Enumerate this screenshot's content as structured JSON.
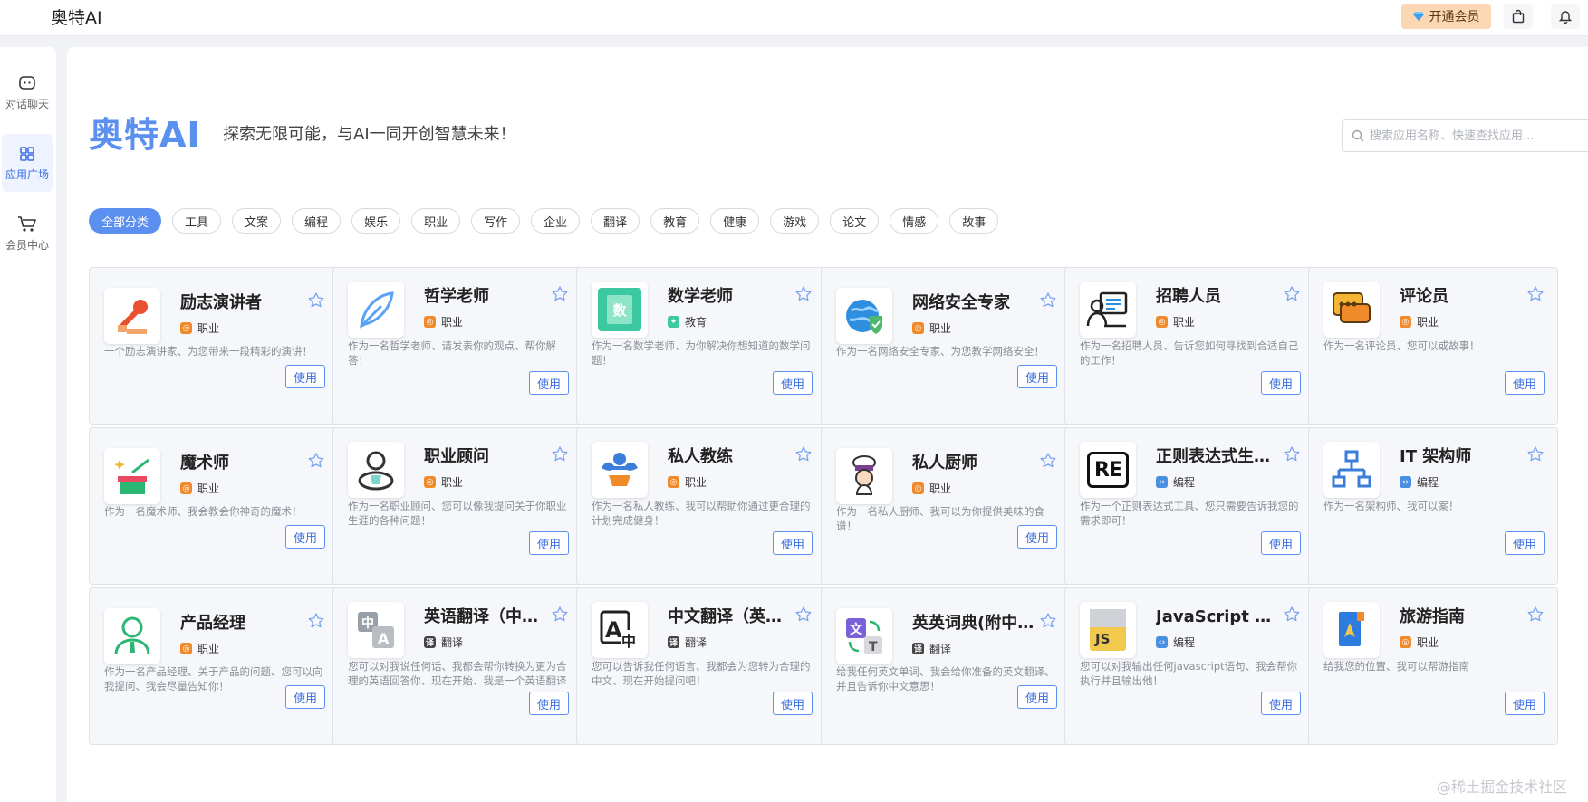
{
  "app": {
    "logo": "奥特AI"
  },
  "header": {
    "vip_label": "开通会员"
  },
  "sidebar": {
    "items": [
      {
        "label": "对话聊天",
        "icon": "chat-icon"
      },
      {
        "label": "应用广场",
        "icon": "grid-icon",
        "active": true
      },
      {
        "label": "会员中心",
        "icon": "cart-icon"
      }
    ]
  },
  "hero": {
    "title": "奥特AI",
    "subtitle": "探索无限可能，与AI一同开创智慧未来！"
  },
  "search": {
    "placeholder": "搜索应用名称、快速查找应用..."
  },
  "categories": [
    "全部分类",
    "工具",
    "文案",
    "编程",
    "娱乐",
    "职业",
    "写作",
    "企业",
    "翻译",
    "教育",
    "健康",
    "游戏",
    "论文",
    "情感",
    "故事"
  ],
  "active_category": "全部分类",
  "use_label": "使用",
  "cards": [
    {
      "title": "励志演讲者",
      "tag": "职业",
      "tag_icon": "career",
      "desc": "一个励志演讲家、为您带来一段精彩的演讲！",
      "icon": "microphone-icon"
    },
    {
      "title": "哲学老师",
      "tag": "职业",
      "tag_icon": "career",
      "desc": "作为一名哲学老师、请发表你的观点、帮你解答！",
      "icon": "feather-icon"
    },
    {
      "title": "数学老师",
      "tag": "教育",
      "tag_icon": "edu",
      "desc": "作为一名数学老师、为你解决你想知道的数学问题！",
      "icon": "math-book-icon",
      "icon_text": "数"
    },
    {
      "title": "网络安全专家",
      "tag": "职业",
      "tag_icon": "career",
      "desc": "作为一名网络安全专家、为您教学网络安全！",
      "icon": "globe-shield-icon"
    },
    {
      "title": "招聘人员",
      "tag": "职业",
      "tag_icon": "career",
      "desc": "作为一名招聘人员、告诉您如何寻找到合适自己的工作！",
      "icon": "recruiter-icon"
    },
    {
      "title": "评论员",
      "tag": "职业",
      "tag_icon": "career",
      "desc": "作为一名评论员、您可以或故事！",
      "icon": "comment-bubbles-icon"
    },
    {
      "title": "魔术师",
      "tag": "职业",
      "tag_icon": "career",
      "desc": "作为一名魔术师、我会教会你神奇的魔术！",
      "icon": "magic-hat-icon"
    },
    {
      "title": "职业顾问",
      "tag": "职业",
      "tag_icon": "career",
      "desc": "作为一名职业顾问、您可以像我提问关于你职业生涯的各种问题！",
      "icon": "advisor-icon"
    },
    {
      "title": "私人教练",
      "tag": "职业",
      "tag_icon": "career",
      "desc": "作为一名私人教练、我可以帮助你通过更合理的计划完成健身！",
      "icon": "muscle-icon"
    },
    {
      "title": "私人厨师",
      "tag": "职业",
      "tag_icon": "career",
      "desc": "作为一名私人厨师、我可以为你提供美味的食谱！",
      "icon": "chef-icon"
    },
    {
      "title": "正则表达式生成器",
      "tag": "编程",
      "tag_icon": "code",
      "desc": "作为一个正则表达式工具、您只需要告诉我您的需求即可！",
      "icon": "regex-icon",
      "icon_text": "RE"
    },
    {
      "title": "IT 架构师",
      "tag": "编程",
      "tag_icon": "code",
      "desc": "作为一名架构师、我可以案！",
      "icon": "architecture-icon"
    },
    {
      "title": "产品经理",
      "tag": "职业",
      "tag_icon": "career",
      "desc": "作为一名产品经理、关于产品的问题、您可以向我提问、我会尽量告知你！",
      "icon": "manager-icon"
    },
    {
      "title": "英语翻译（中译英）",
      "tag": "翻译",
      "tag_icon": "translate",
      "desc": "您可以对我说任何话、我都会帮你转换为更为合理的英语回答你、现在开始、我是一个英语翻译",
      "icon": "translate-zh-a-icon"
    },
    {
      "title": "中文翻译（英译中）",
      "tag": "翻译",
      "tag_icon": "translate",
      "desc": "您可以告诉我任何语言、我都会为您转为合理的中文、现在开始提问吧！",
      "icon": "translate-a-zh-icon"
    },
    {
      "title": "英英词典(附中文解释)",
      "tag": "翻译",
      "tag_icon": "translate",
      "desc": "给我任何英文单词、我会给你准备的英文翻译、并且告诉你中文意思！",
      "icon": "dictionary-icon"
    },
    {
      "title": "JavaScript 控制台",
      "tag": "编程",
      "tag_icon": "code",
      "desc": "您可以对我输出任何javascript语句、我会帮你执行并且输出他！",
      "icon": "js-file-icon",
      "icon_text": "JS"
    },
    {
      "title": "旅游指南",
      "tag": "职业",
      "tag_icon": "career",
      "desc": "给我您的位置、我可以帮游指南",
      "icon": "travel-book-icon"
    }
  ],
  "watermark": "@稀土掘金技术社区",
  "colors": {
    "accent": "#5b8ff0",
    "vip_bg": "#fcd7b4",
    "career_tag": "#f08a2a",
    "code_tag": "#4a90e2"
  }
}
